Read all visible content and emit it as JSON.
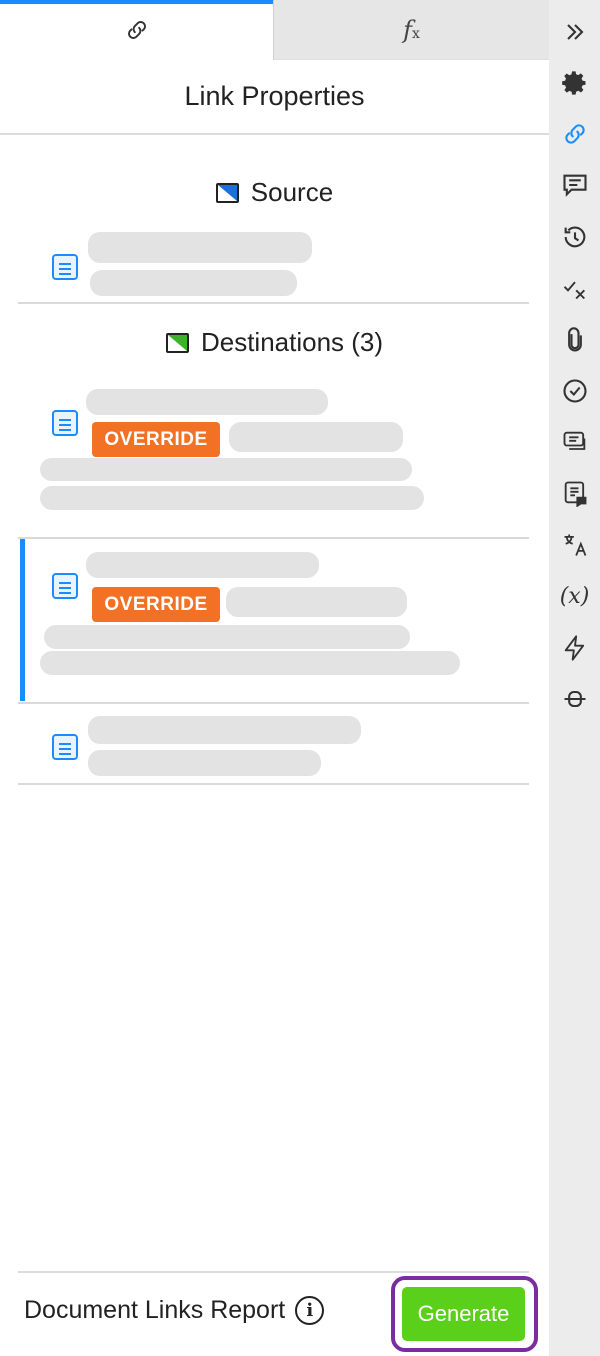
{
  "tabs": [
    {
      "icon": "link-icon"
    },
    {
      "icon": "function-icon",
      "label": "f",
      "sub": "x"
    }
  ],
  "panel_title": "Link Properties",
  "source": {
    "heading": "Source"
  },
  "destinations": {
    "heading": "Destinations (3)"
  },
  "badges": {
    "override": "OVERRIDE"
  },
  "footer": {
    "label": "Document Links Report",
    "generate": "Generate"
  },
  "rail": {
    "items": [
      "collapse-icon",
      "gear-icon",
      "link-icon",
      "comment-icon",
      "history-icon",
      "check-x-icon",
      "attachment-icon",
      "check-circle-icon",
      "comments-list-icon",
      "review-icon",
      "translate-icon",
      "variable-icon",
      "lightning-icon",
      "connector-icon"
    ],
    "variable_label": "(x)"
  },
  "colors": {
    "accent": "#1a8cff",
    "override": "#f27125",
    "generate": "#5ad01a",
    "highlight": "#7a2d9e"
  }
}
